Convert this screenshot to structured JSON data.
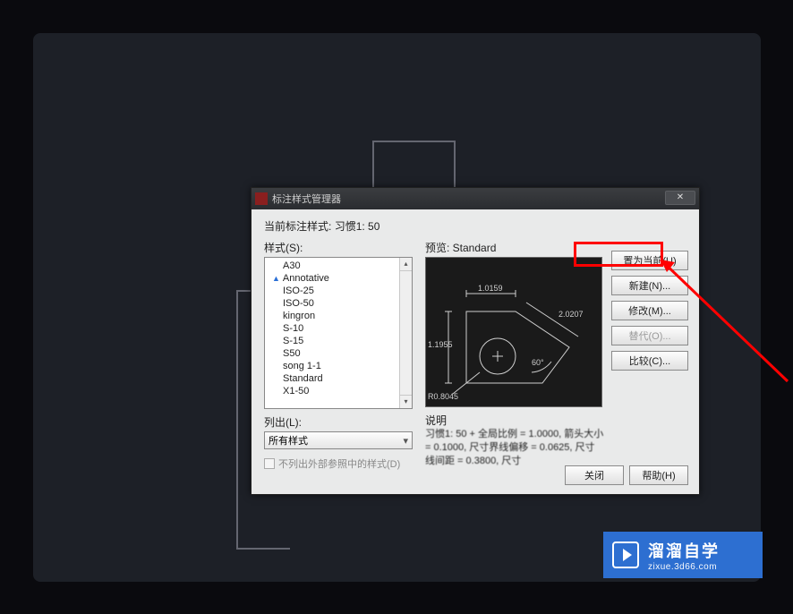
{
  "dialog": {
    "title": "标注样式管理器",
    "current_style_label": "当前标注样式:",
    "current_style_value": "习惯1: 50",
    "styles_label": "样式(S):",
    "styles": [
      "A30",
      "Annotative",
      "ISO-25",
      "ISO-50",
      "kingron",
      "S-10",
      "S-15",
      "S50",
      "song 1-1",
      "Standard",
      "X1-50"
    ],
    "list_label": "列出(L):",
    "dropdown_value": "所有样式",
    "checkbox_label": "不列出外部参照中的样式(D)",
    "preview_label": "预览: Standard",
    "preview_values": {
      "top_dim": "1.0159",
      "left_dim": "1.1955",
      "right_dim": "2.0207",
      "angle": "60°",
      "radius": "R0.8045"
    },
    "description_label": "说明",
    "description_text": "习惯1: 50 + 全局比例 = 1.0000, 箭头大小 = 0.1000, 尺寸界线偏移 = 0.0625, 尺寸线间距 = 0.3800, 尺寸",
    "buttons": {
      "set_current": "置为当前(U)",
      "new": "新建(N)...",
      "modify": "修改(M)...",
      "override": "替代(O)...",
      "compare": "比较(C)...",
      "close": "关闭",
      "help": "帮助(H)"
    }
  },
  "watermark": {
    "line1": "溜溜自学",
    "line2": "zixue.3d66.com"
  },
  "annotation": {
    "highlighted_button": "new"
  }
}
